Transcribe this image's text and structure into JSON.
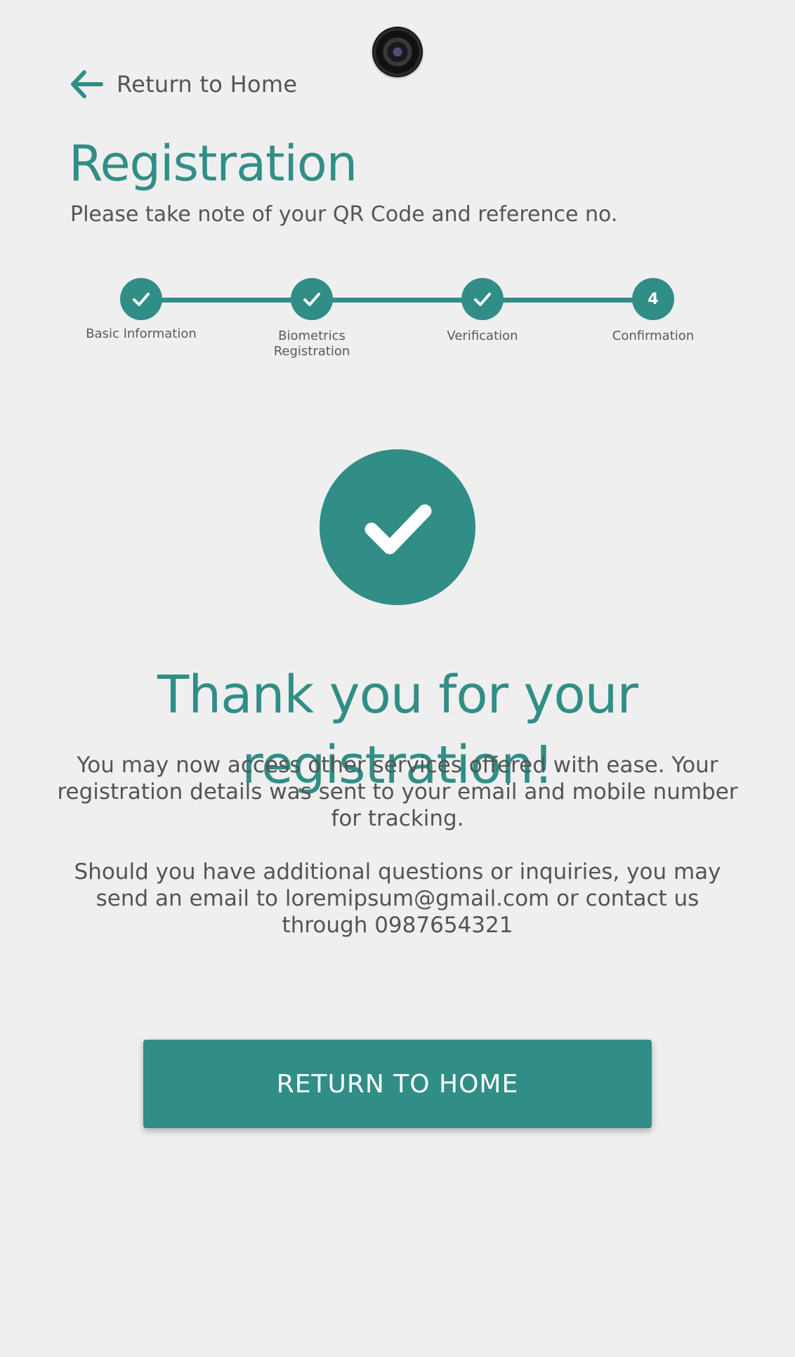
{
  "header": {
    "back_label": "Return to Home",
    "title": "Registration",
    "subtitle": "Please take note of your QR Code and reference no."
  },
  "stepper": {
    "steps": [
      {
        "label": "Basic Information",
        "state": "done"
      },
      {
        "label": "Biometrics Registration",
        "state": "done"
      },
      {
        "label": "Verification",
        "state": "done"
      },
      {
        "label": "Confirmation",
        "state": "current",
        "number": "4"
      }
    ]
  },
  "confirmation": {
    "heading": "Thank you for your registration!",
    "paragraph_1": "You may now access other services offered with ease. Your registration details was sent to your email and mobile number for tracking.",
    "paragraph_2": "Should you have additional questions or inquiries, you may send an email to loremipsum@gmail.com or contact us through 0987654321"
  },
  "actions": {
    "return_home_button": "RETURN TO HOME"
  },
  "icons": {
    "back": "arrow-left-icon",
    "step_done": "checkmark-icon",
    "success": "checkmark-icon",
    "camera": "camera-icon"
  },
  "colors": {
    "accent": "#308e86",
    "background": "#efefef",
    "text": "#545454"
  }
}
